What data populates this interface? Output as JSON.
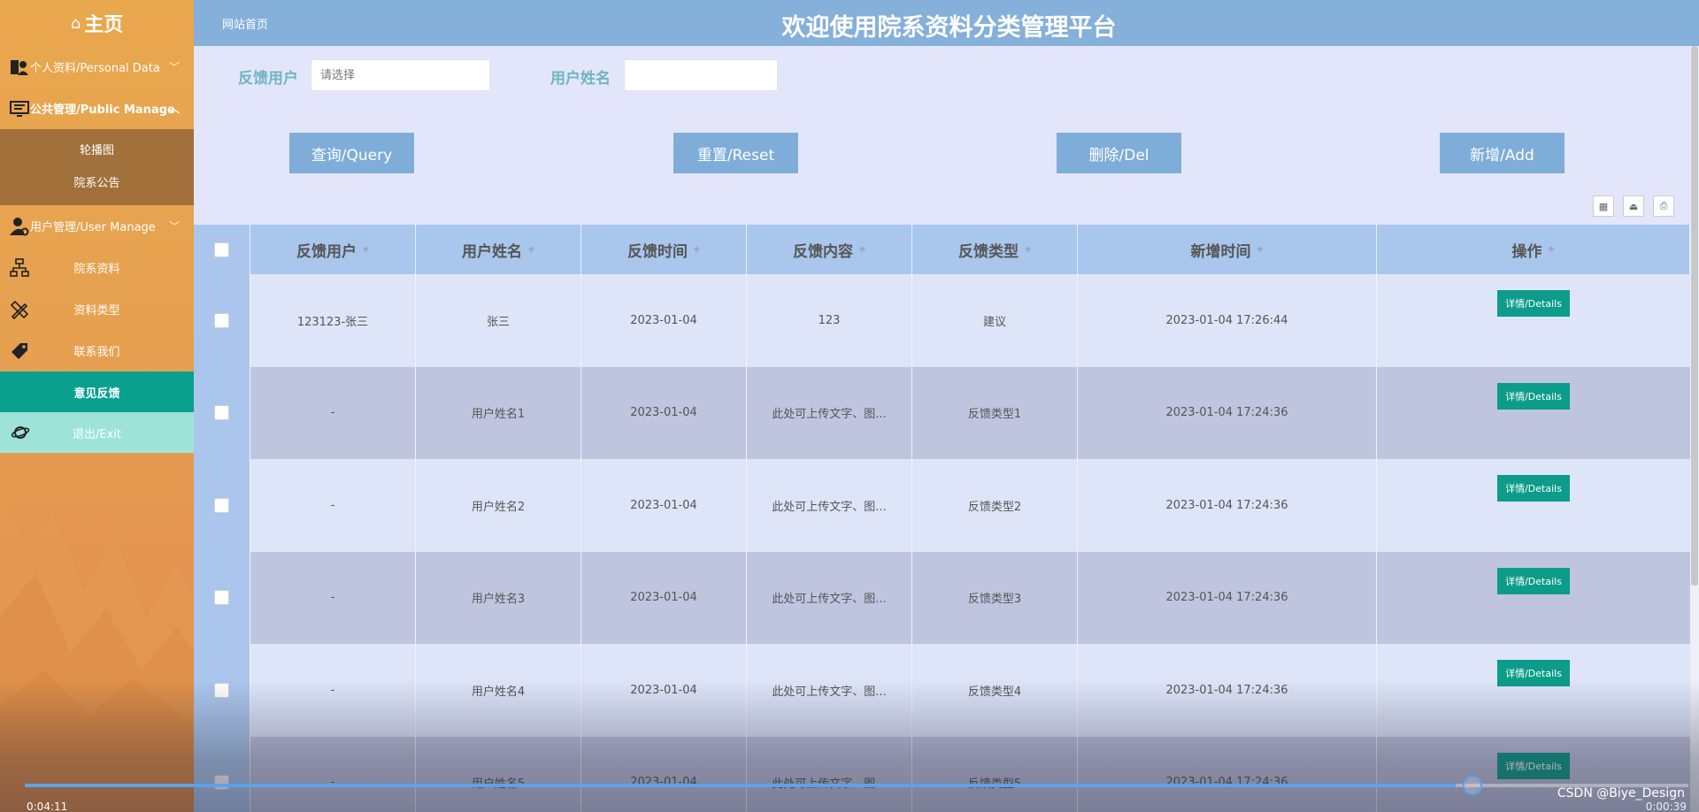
{
  "sidebar": {
    "title": "主页",
    "items": [
      {
        "label": "个人资料/Personal Data",
        "icon": "user-card-icon"
      },
      {
        "label": "公共管理/Public Manage",
        "icon": "monitor-list-icon"
      },
      {
        "label": "用户管理/User Manage",
        "icon": "user-gear-icon"
      },
      {
        "label": "院系资料",
        "icon": "org-chart-icon"
      },
      {
        "label": "资料类型",
        "icon": "pencil-ruler-icon"
      },
      {
        "label": "联系我们",
        "icon": "tag-icon"
      }
    ],
    "public_sub": [
      "轮播图",
      "院系公告"
    ],
    "active": "意见反馈",
    "exit": "退出/Exit"
  },
  "header": {
    "home_link": "网站首页",
    "title": "欢迎使用院系资料分类管理平台"
  },
  "search": {
    "user_label": "反馈用户",
    "user_placeholder": "请选择",
    "name_label": "用户姓名",
    "name_value": ""
  },
  "buttons": {
    "query": "查询/Query",
    "reset": "重置/Reset",
    "delete": "删除/Del",
    "add": "新增/Add"
  },
  "table": {
    "columns": [
      "反馈用户",
      "用户姓名",
      "反馈时间",
      "反馈内容",
      "反馈类型",
      "新增时间",
      "操作"
    ],
    "rows": [
      {
        "user": "123123-张三",
        "name": "张三",
        "time": "2023-01-04",
        "content": "123",
        "type": "建议",
        "added": "2023-01-04 17:26:44",
        "action": "详情/Details"
      },
      {
        "user": "-",
        "name": "用户姓名1",
        "time": "2023-01-04",
        "content": "此处可上传文字、图...",
        "type": "反馈类型1",
        "added": "2023-01-04 17:24:36",
        "action": "详情/Details"
      },
      {
        "user": "-",
        "name": "用户姓名2",
        "time": "2023-01-04",
        "content": "此处可上传文字、图...",
        "type": "反馈类型2",
        "added": "2023-01-04 17:24:36",
        "action": "详情/Details"
      },
      {
        "user": "-",
        "name": "用户姓名3",
        "time": "2023-01-04",
        "content": "此处可上传文字、图...",
        "type": "反馈类型3",
        "added": "2023-01-04 17:24:36",
        "action": "详情/Details"
      },
      {
        "user": "-",
        "name": "用户姓名4",
        "time": "2023-01-04",
        "content": "此处可上传文字、图...",
        "type": "反馈类型4",
        "added": "2023-01-04 17:24:36",
        "action": "详情/Details"
      },
      {
        "user": "-",
        "name": "用户姓名5",
        "time": "2023-01-04",
        "content": "此处可上传文字、图...",
        "type": "反馈类型5",
        "added": "2023-01-04 17:24:36",
        "action": "详情/Details"
      }
    ]
  },
  "video": {
    "elapsed": "0:04:11",
    "duration": "0:00:39",
    "progress": 0.86,
    "watermark": "CSDN @Biye_Design"
  },
  "colors": {
    "sidebar": "#e6a150",
    "header": "#84b0da",
    "button": "#7fadd9",
    "active": "#09a08d",
    "detail_button": "#0c9c89"
  }
}
